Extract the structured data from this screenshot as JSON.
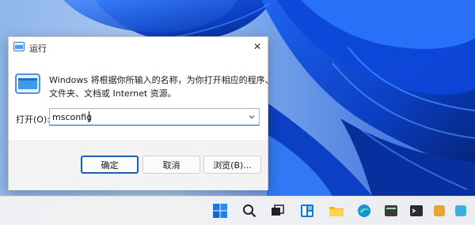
{
  "dialog": {
    "title": "运行",
    "close_glyph": "✕",
    "description_line1": "Windows 将根据你所输入的名称，为你打开相应的程序、",
    "description_line2": "文件夹、文档或 Internet 资源。",
    "open_label": "打开(O):",
    "open_value": "msconfig",
    "ok_label": "确定",
    "cancel_label": "取消",
    "browse_label": "浏览(B)...",
    "icon_name": "run-icon"
  },
  "taskbar": {
    "icons": [
      "windows-start-icon",
      "search-icon",
      "task-view-icon",
      "widgets-icon",
      "file-explorer-icon",
      "edge-icon",
      "app-icon",
      "terminal-icon",
      "app-icon-2",
      "app-icon-3"
    ]
  },
  "colors": {
    "accent": "#1a5fb4",
    "wallpaper_blue": "#0a48d6",
    "wallpaper_light": "#9fc2ee"
  }
}
